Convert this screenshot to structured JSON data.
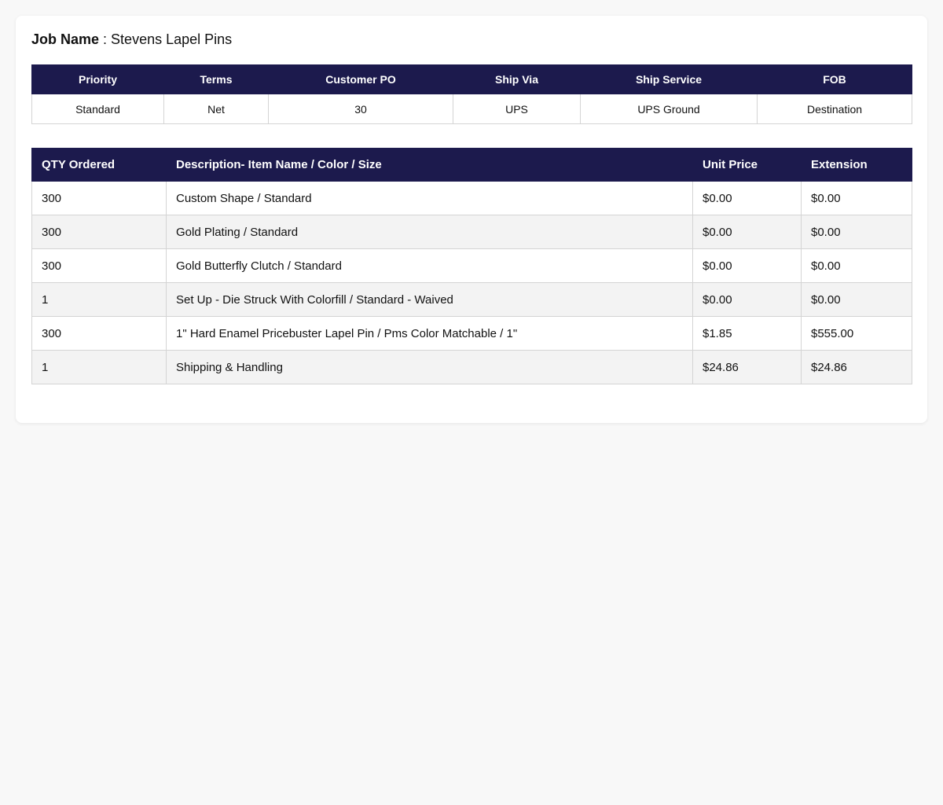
{
  "job": {
    "label": "Job Name",
    "separator": " : ",
    "value": "Stevens Lapel Pins"
  },
  "order_info": {
    "headers": [
      "Priority",
      "Terms",
      "Customer PO",
      "Ship Via",
      "Ship Service",
      "FOB"
    ],
    "values": [
      "Standard",
      "Net",
      "30",
      "UPS",
      "UPS Ground",
      "Destination"
    ]
  },
  "items": {
    "headers": [
      "QTY Ordered",
      "Description- Item Name / Color / Size",
      "Unit Price",
      "Extension"
    ],
    "rows": [
      {
        "qty": "300",
        "description": "Custom Shape / Standard",
        "unit_price": "$0.00",
        "extension": "$0.00"
      },
      {
        "qty": "300",
        "description": "Gold Plating / Standard",
        "unit_price": "$0.00",
        "extension": "$0.00"
      },
      {
        "qty": "300",
        "description": "Gold Butterfly Clutch / Standard",
        "unit_price": "$0.00",
        "extension": "$0.00"
      },
      {
        "qty": "1",
        "description": "Set Up - Die Struck With Colorfill / Standard - Waived",
        "unit_price": "$0.00",
        "extension": "$0.00"
      },
      {
        "qty": "300",
        "description": "1\" Hard Enamel Pricebuster Lapel Pin / Pms Color Matchable / 1\"",
        "unit_price": "$1.85",
        "extension": "$555.00"
      },
      {
        "qty": "1",
        "description": "Shipping & Handling",
        "unit_price": "$24.86",
        "extension": "$24.86"
      }
    ]
  },
  "colors": {
    "header_bg": "#1c1a4d",
    "header_text": "#ffffff",
    "row_alt_bg": "#f3f3f3",
    "page_bg": "#f8f8f8"
  }
}
